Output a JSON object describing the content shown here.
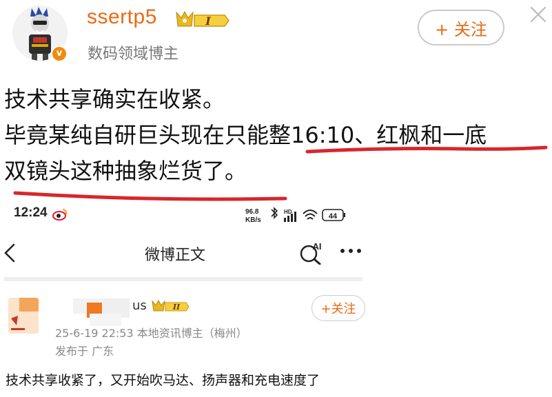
{
  "post": {
    "username": "ssertp5",
    "level_badge": "I",
    "verified_badge": "v",
    "user_title": "数码领域博主",
    "follow_label": "+ 关注",
    "text_lines": [
      "技术共享确实在收紧。",
      "毕竟某纯自研巨头现在只能整16:10、红枫和一底",
      "双镜头这种抽象烂货了。"
    ]
  },
  "embedded": {
    "status_time": "12:24",
    "status_net_speed_top": "96.8",
    "status_net_speed_bottom": "KB/s",
    "status_signal": "HD",
    "status_battery": "44",
    "nav_title": "微博正文",
    "ai_label": "AI",
    "author_name_tail": "us",
    "level_badge": "II",
    "author_meta": "25-6-19 22:53  本地资讯博主（梅州）",
    "author_location": "发布于 广东",
    "follow_label": "+关注",
    "body_text": "技术共享收紧了，又开始吹马达、扬声器和充电速度了"
  },
  "colors": {
    "accent_orange": "#ea6a14",
    "underline_red": "#d8262b",
    "gold": "#e8b820"
  }
}
